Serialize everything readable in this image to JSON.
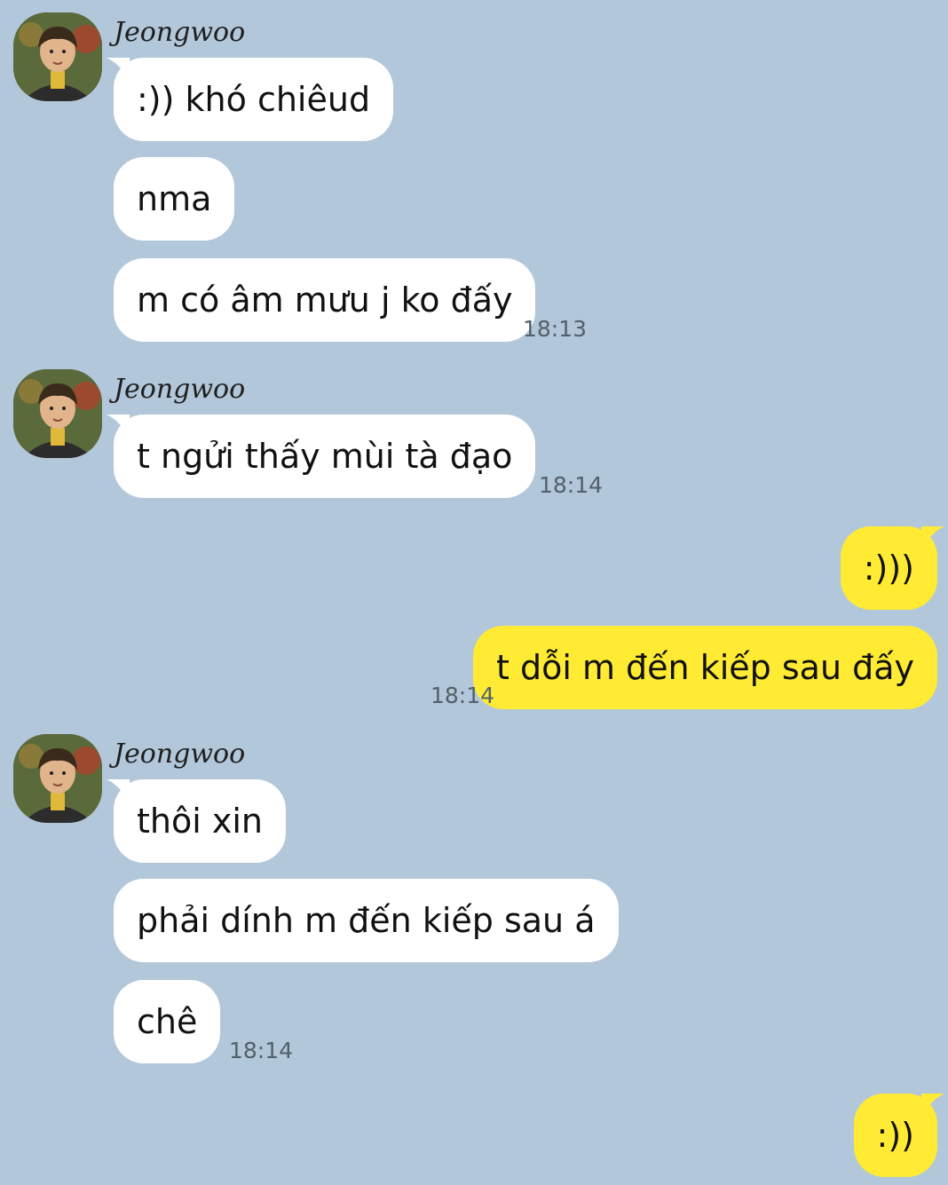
{
  "sender": {
    "name": "Jeongwoo"
  },
  "groups": [
    {
      "messages": [
        ":)) khó chiêud",
        "nma",
        "m có âm mưu j ko đấy"
      ],
      "time": "18:13"
    },
    {
      "messages": [
        "t ngửi thấy mùi tà đạo"
      ],
      "time": "18:14"
    },
    {
      "messages": [
        "thôi xin",
        "phải dính m đến kiếp sau á",
        "chê"
      ],
      "time": "18:14"
    }
  ],
  "outgoing": [
    {
      "messages": [
        ":)))",
        "t dỗi m đến kiếp sau đấy"
      ],
      "time": "18:14"
    },
    {
      "messages": [
        ":))"
      ]
    }
  ],
  "colors": {
    "background": "#b2c7da",
    "incoming_bubble": "#ffffff",
    "outgoing_bubble": "#ffeb33",
    "timestamp": "#53606a"
  }
}
